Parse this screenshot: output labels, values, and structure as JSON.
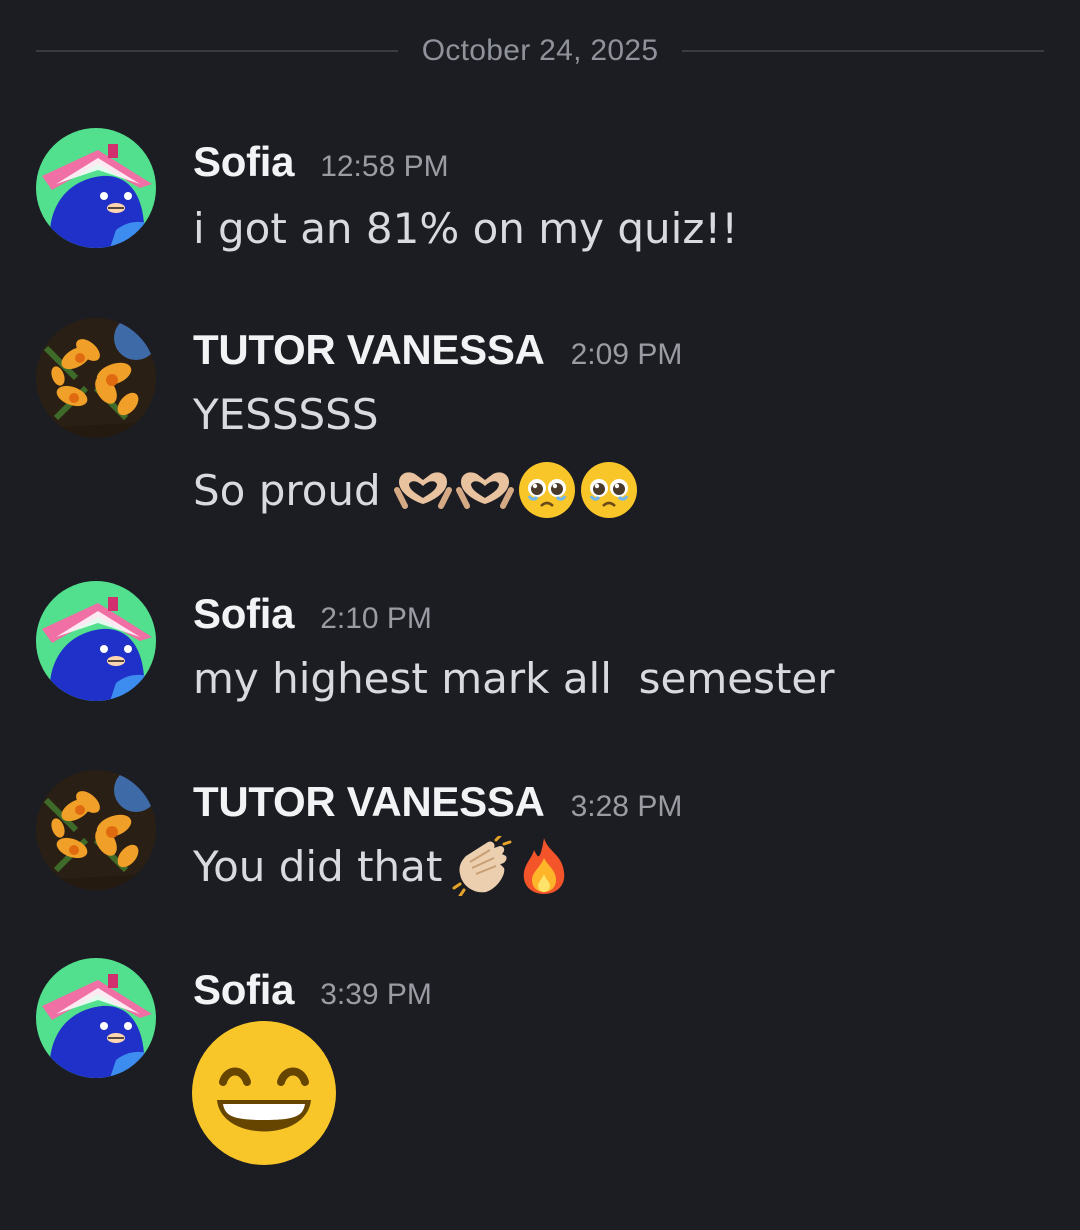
{
  "date_divider": "October 24, 2025",
  "messages": [
    {
      "author": "Sofia",
      "time": "12:58 PM",
      "lines": [
        "i got an 81% on my quiz!!"
      ]
    },
    {
      "author": "TUTOR VANESSA",
      "time": "2:09 PM",
      "lines": [
        "YESSSSS",
        "So proud"
      ],
      "emojis_line2": [
        "heart-hands-emoji",
        "heart-hands-emoji",
        "pleading-face-emoji",
        "pleading-face-emoji"
      ]
    },
    {
      "author": "Sofia",
      "time": "2:10 PM",
      "lines": [
        "my highest mark all  semester"
      ]
    },
    {
      "author": "TUTOR VANESSA",
      "time": "3:28 PM",
      "lines": [
        "You did that"
      ],
      "emojis_line1": [
        "clapping-hands-emoji",
        "fire-emoji"
      ]
    },
    {
      "author": "Sofia",
      "time": "3:39 PM",
      "lines": [],
      "big_emoji": "grinning-face-emoji"
    }
  ],
  "colors": {
    "background": "#1c1d22",
    "username": "#f2f3f5",
    "timestamp": "#9a9ca4",
    "message_text": "#d9dae0",
    "sofia_avatar_bg": "#4fe08f",
    "tutor_avatar_bg": "#2a1f14"
  }
}
